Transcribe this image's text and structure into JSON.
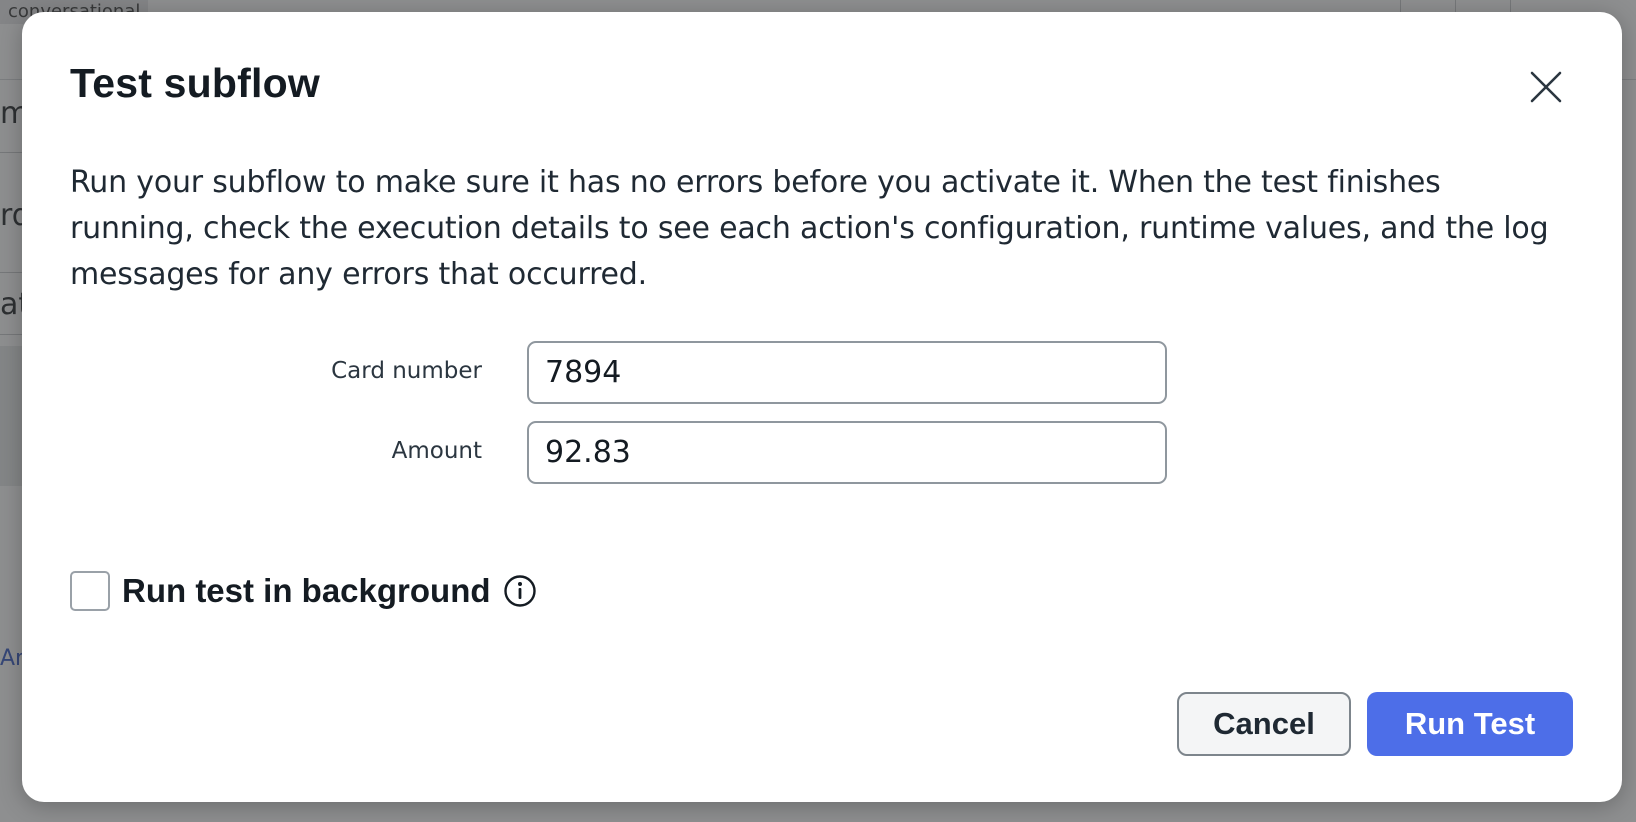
{
  "background": {
    "chip_text": "conversational",
    "fragments": [
      "m",
      "rd",
      "atu"
    ],
    "link_fragment": "Am"
  },
  "dialog": {
    "title": "Test subflow",
    "close_icon": "close-icon",
    "description": "Run your subflow to make sure it has no errors before you activate it. When the test finishes running, check the execution details to see each action's configuration, runtime values, and the log messages for any errors that occurred.",
    "fields": [
      {
        "label": "Card number",
        "value": "7894"
      },
      {
        "label": "Amount",
        "value": "92.83"
      }
    ],
    "background_option": {
      "label": "Run test in background",
      "checked": false,
      "info_icon": "info-circle-icon"
    },
    "buttons": {
      "cancel": "Cancel",
      "run": "Run Test"
    }
  },
  "colors": {
    "primary": "#4d6ee8",
    "text": "#141b22",
    "overlay": "rgba(60,62,64,0.58)"
  }
}
